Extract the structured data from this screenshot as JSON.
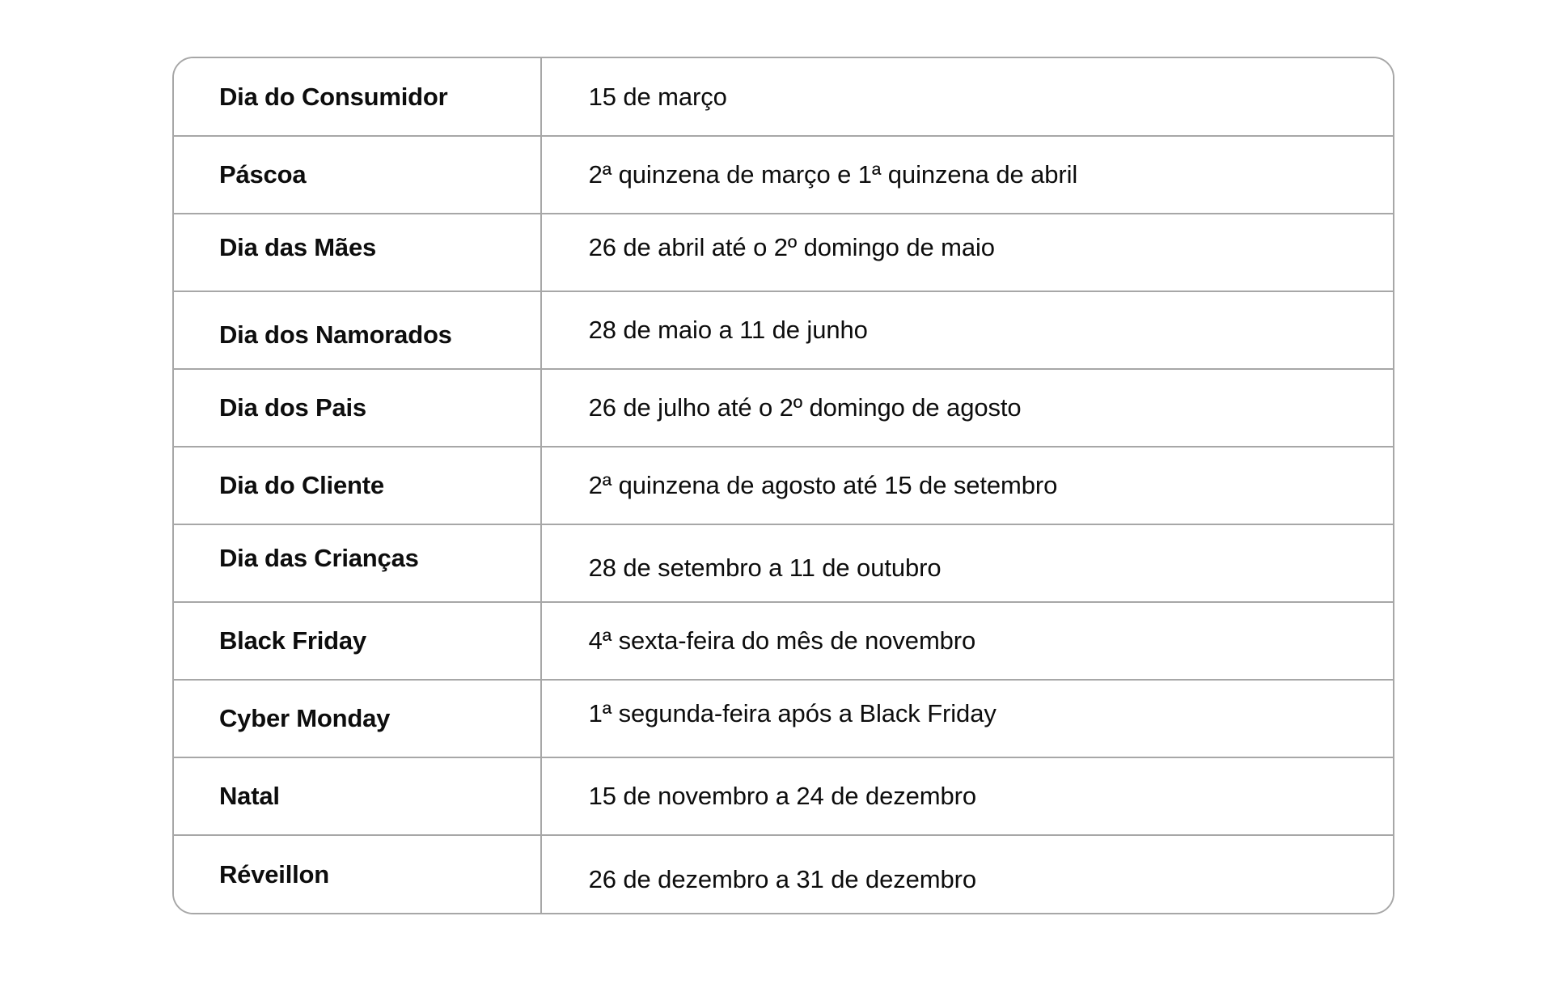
{
  "page": {
    "background_color": "#ffffff",
    "text_color": "#0d0d0d",
    "border_color": "#a7a7a7"
  },
  "table": {
    "name": "calendario-datas-comemorativas",
    "columns": [
      {
        "key": "name",
        "header": ""
      },
      {
        "key": "period",
        "header": ""
      }
    ],
    "rows": [
      {
        "name": "Dia do Consumidor",
        "period": "15 de março"
      },
      {
        "name": "Páscoa",
        "period": "2ª quinzena de março e 1ª quinzena de abril"
      },
      {
        "name": "Dia das Mães",
        "period": "26 de abril até o 2º domingo de maio"
      },
      {
        "name": "Dia dos Namorados",
        "period": "28 de maio a 11 de junho"
      },
      {
        "name": "Dia dos Pais",
        "period": "26 de julho até o 2º domingo de agosto"
      },
      {
        "name": "Dia do Cliente",
        "period": "2ª quinzena de agosto até 15 de setembro"
      },
      {
        "name": "Dia das Crianças",
        "period": "28 de setembro a 11 de outubro"
      },
      {
        "name": "Black Friday",
        "period": "4ª sexta-feira do mês de novembro"
      },
      {
        "name": "Cyber Monday",
        "period": "1ª segunda-feira após a Black Friday"
      },
      {
        "name": "Natal",
        "period": "15 de novembro a 24 de dezembro"
      },
      {
        "name": "Réveillon",
        "period": "26 de dezembro a 31 de dezembro"
      }
    ]
  }
}
